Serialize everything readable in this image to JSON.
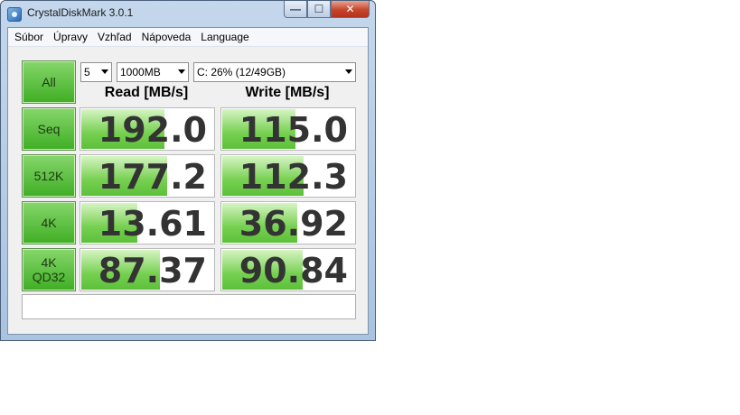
{
  "window": {
    "title": "CrystalDiskMark 3.0.1",
    "min_label": "—",
    "max_label": "☐",
    "close_label": "✕"
  },
  "menu": [
    "Súbor",
    "Úpravy",
    "Vzhľad",
    "Nápoveda",
    "Language"
  ],
  "controls": {
    "all_label": "All",
    "count_value": "5",
    "size_value": "1000MB",
    "drive_value": "C: 26% (12/49GB)"
  },
  "headers": {
    "read": "Read [MB/s]",
    "write": "Write [MB/s]"
  },
  "rows": [
    {
      "label_line1": "Seq",
      "label_line2": "",
      "read": "192.0",
      "write": "115.0",
      "read_fill": 0.62,
      "write_fill": 0.55
    },
    {
      "label_line1": "512K",
      "label_line2": "",
      "read": "177.2",
      "write": "112.3",
      "read_fill": 0.64,
      "write_fill": 0.61
    },
    {
      "label_line1": "4K",
      "label_line2": "",
      "read": "13.61",
      "write": "36.92",
      "read_fill": 0.42,
      "write_fill": 0.56
    },
    {
      "label_line1": "4K",
      "label_line2": "QD32",
      "read": "87.37",
      "write": "90.84",
      "read_fill": 0.59,
      "write_fill": 0.6
    }
  ],
  "status_text": "",
  "colors": {
    "accent_green": "#5cc03a",
    "value_text": "#333333"
  }
}
